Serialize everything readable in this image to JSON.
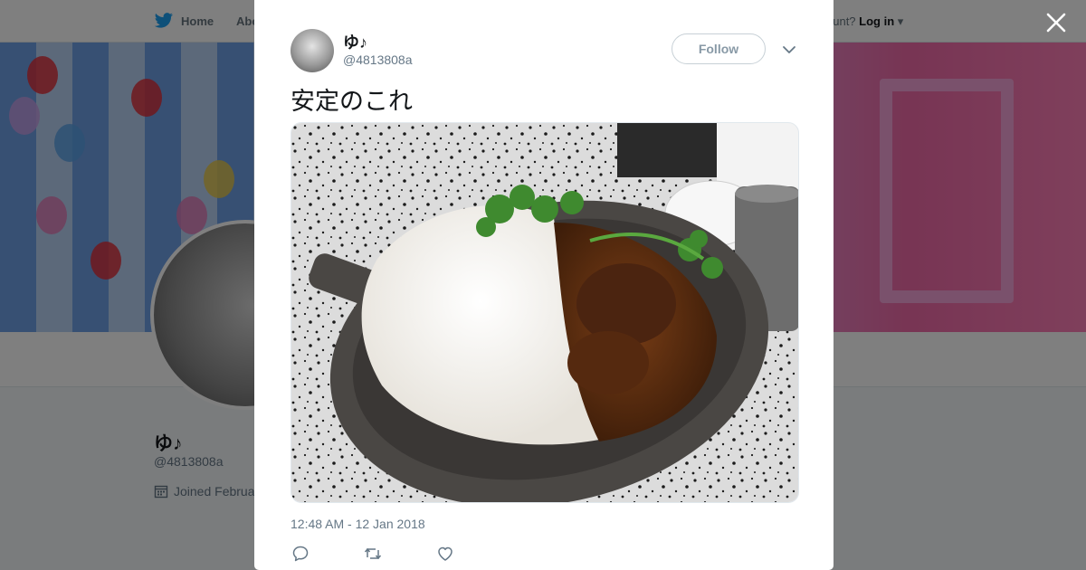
{
  "topbar": {
    "home_label": "Home",
    "about_label": "Abo",
    "account_prompt": "ccount?",
    "login_label": "Log in"
  },
  "profile": {
    "name": "ゆ♪",
    "handle": "@4813808a",
    "joined": "Joined Februa"
  },
  "tweet": {
    "author_name": "ゆ♪",
    "author_handle": "@4813808a",
    "follow_label": "Follow",
    "text": "安定のこれ",
    "timestamp": "12:48 AM - 12 Jan 2018"
  },
  "colors": {
    "brand": "#1da1f2",
    "muted": "#657786",
    "dark_text": "#14171a"
  },
  "icons": {
    "close": "close-icon",
    "caret": "chevron-down-icon",
    "reply": "reply-icon",
    "retweet": "retweet-icon",
    "like": "heart-icon",
    "calendar": "calendar-icon",
    "bird": "twitter-bird-icon"
  }
}
